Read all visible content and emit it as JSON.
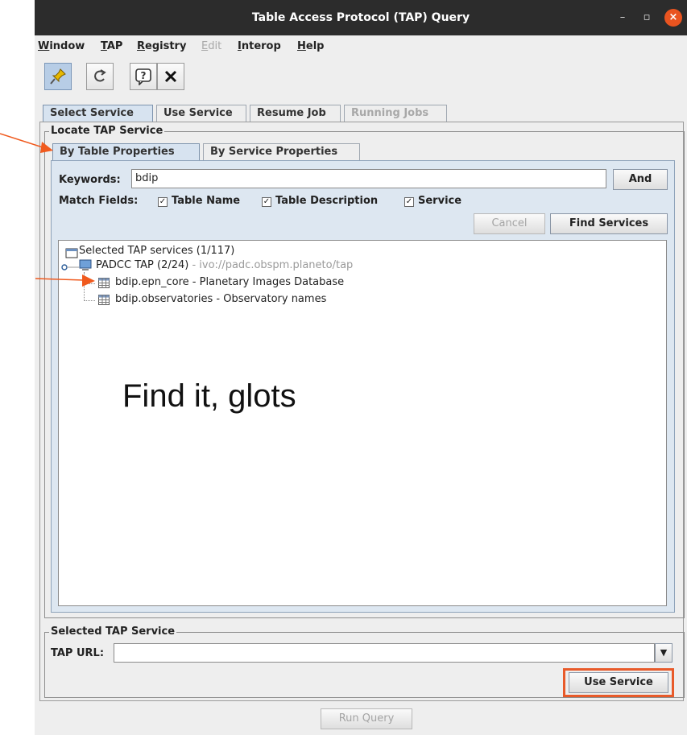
{
  "window": {
    "title": "Table Access Protocol (TAP) Query"
  },
  "titlebar_icons": {
    "minimize": "minimize-icon",
    "maximize": "maximize-icon",
    "close": "close-icon"
  },
  "menu": [
    {
      "label": "Window",
      "underline": "W",
      "rest": "indow",
      "enabled": true
    },
    {
      "label": "TAP",
      "underline": "T",
      "rest": "AP",
      "enabled": true
    },
    {
      "label": "Registry",
      "underline": "R",
      "rest": "egistry",
      "enabled": true
    },
    {
      "label": "Edit",
      "underline": "E",
      "rest": "dit",
      "enabled": false
    },
    {
      "label": "Interop",
      "underline": "I",
      "rest": "nterop",
      "enabled": true
    },
    {
      "label": "Help",
      "underline": "H",
      "rest": "elp",
      "enabled": true
    }
  ],
  "toolbar": [
    {
      "icon": "pin-icon",
      "glyph": "📌"
    },
    {
      "icon": "reload-icon",
      "glyph": "⟳"
    },
    {
      "icon": "help-icon",
      "glyph": "?"
    },
    {
      "icon": "close-icon",
      "glyph": "✕"
    }
  ],
  "main_tabs": [
    {
      "label": "Select Service",
      "selected": true,
      "enabled": true
    },
    {
      "label": "Use Service",
      "selected": false,
      "enabled": true
    },
    {
      "label": "Resume Job",
      "selected": false,
      "enabled": true
    },
    {
      "label": "Running Jobs",
      "selected": false,
      "enabled": false
    }
  ],
  "locate": {
    "title": "Locate TAP Service",
    "tabs": [
      {
        "label": "By Table Properties",
        "selected": true
      },
      {
        "label": "By Service Properties",
        "selected": false
      }
    ],
    "keywords_label": "Keywords:",
    "keywords_value": "bdip",
    "and_button": "And",
    "match_label": "Match Fields:",
    "match_fields": [
      {
        "label": "Table Name",
        "checked": true
      },
      {
        "label": "Table Description",
        "checked": true
      },
      {
        "label": "Service",
        "checked": true
      }
    ],
    "cancel_button": "Cancel",
    "find_button": "Find Services"
  },
  "tree": {
    "root": "Selected TAP services (1/117)",
    "service_name": "PADCC TAP (2/24)",
    "service_url": " - ivo://padc.obspm.planeto/tap",
    "tables": [
      "bdip.epn_core - Planetary Images Database",
      "bdip.observatories - Observatory names"
    ]
  },
  "annotation": {
    "text": "Find it, glots",
    "arrow_color": "#f05a1e"
  },
  "selected": {
    "title": "Selected TAP Service",
    "url_label": "TAP URL:",
    "url_value": "",
    "use_button": "Use Service"
  },
  "run_query_button": "Run Query",
  "colors": {
    "highlight": "#e85a2a",
    "close_button": "#e95420"
  }
}
